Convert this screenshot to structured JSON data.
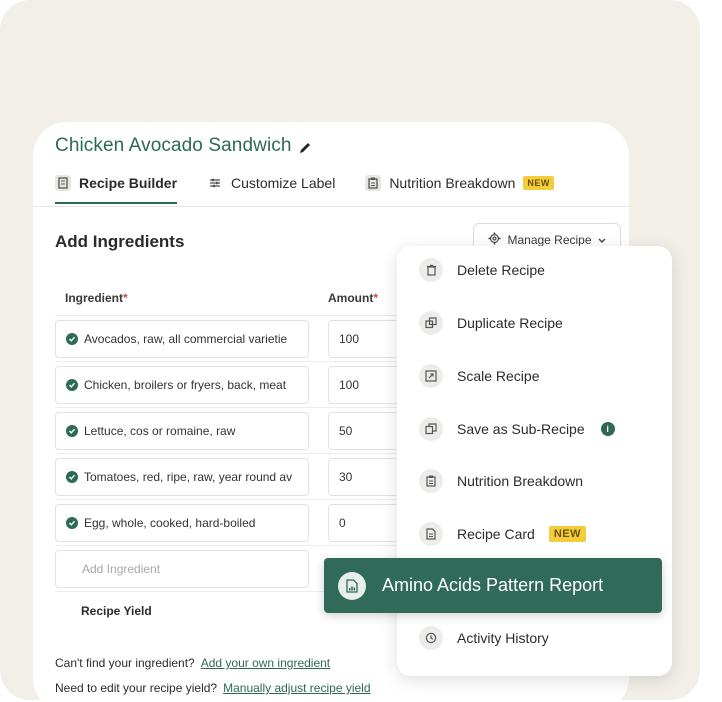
{
  "recipe": {
    "title": "Chicken Avocado Sandwich"
  },
  "tabs": [
    {
      "label": "Recipe Builder",
      "active": true,
      "icon": "recipe-builder-icon"
    },
    {
      "label": "Customize Label",
      "active": false,
      "icon": "sliders-icon"
    },
    {
      "label": "Nutrition Breakdown",
      "active": false,
      "icon": "clipboard-icon",
      "badge": "NEW"
    }
  ],
  "section": {
    "title": "Add Ingredients"
  },
  "manage": {
    "label": "Manage Recipe"
  },
  "columns": {
    "ingredient": "Ingredient",
    "amount": "Amount",
    "required_mark": "*"
  },
  "ingredients": [
    {
      "name": "Avocados, raw, all commercial varietie",
      "amount": "100"
    },
    {
      "name": "Chicken, broilers or fryers, back, meat",
      "amount": "100"
    },
    {
      "name": "Lettuce, cos or romaine, raw",
      "amount": "50"
    },
    {
      "name": "Tomatoes, red, ripe, raw, year round av",
      "amount": "30"
    },
    {
      "name": "Egg, whole, cooked, hard-boiled",
      "amount": "0"
    }
  ],
  "add_ingredient": {
    "placeholder": "Add Ingredient"
  },
  "recipe_yield": {
    "label": "Recipe Yield"
  },
  "help": {
    "find_text": "Can't find your ingredient?",
    "find_link": "Add your own ingredient",
    "yield_text": "Need to edit your recipe yield?",
    "yield_link": "Manually adjust recipe yield"
  },
  "menu": {
    "items": [
      {
        "label": "Delete Recipe",
        "icon": "trash-icon"
      },
      {
        "label": "Duplicate Recipe",
        "icon": "duplicate-icon"
      },
      {
        "label": "Scale Recipe",
        "icon": "scale-icon"
      },
      {
        "label": "Save as Sub-Recipe",
        "icon": "copy-icon",
        "info": "i"
      },
      {
        "label": "Nutrition Breakdown",
        "icon": "clipboard-icon"
      },
      {
        "label": "Recipe Card",
        "icon": "recipe-card-icon",
        "badge": "NEW"
      },
      {
        "label": "Activity History",
        "icon": "history-icon"
      }
    ],
    "highlight": {
      "label": "Amino Acids Pattern Report",
      "icon": "report-icon"
    }
  },
  "colors": {
    "brand": "#2d6a55",
    "badge": "#f5cc3c",
    "background": "#f1efe7"
  }
}
